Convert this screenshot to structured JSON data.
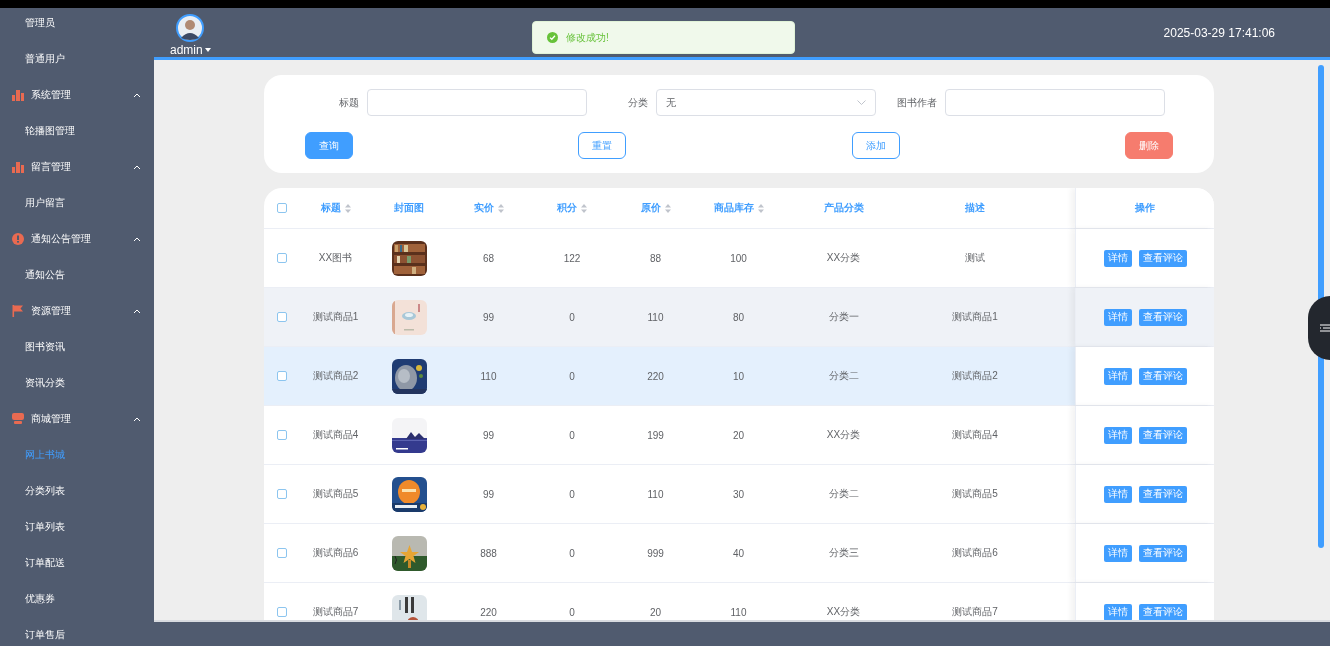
{
  "sidebar": {
    "items": [
      {
        "kind": "link",
        "label": "管理员",
        "selected": false
      },
      {
        "kind": "link",
        "label": "普通用户",
        "selected": false
      },
      {
        "kind": "chart",
        "label": "系统管理",
        "expanded": true,
        "children": [
          {
            "kind": "link",
            "label": "轮播图管理",
            "selected": false
          }
        ]
      },
      {
        "kind": "chart",
        "label": "留言管理",
        "expanded": true,
        "children": [
          {
            "kind": "link",
            "label": "用户留言",
            "selected": false
          }
        ]
      },
      {
        "kind": "info",
        "label": "通知公告管理",
        "expanded": true,
        "children": [
          {
            "kind": "link",
            "label": "通知公告",
            "selected": false
          }
        ]
      },
      {
        "kind": "flag",
        "label": "资源管理",
        "expanded": true,
        "children": [
          {
            "kind": "link",
            "label": "图书资讯",
            "selected": false
          },
          {
            "kind": "link",
            "label": "资讯分类",
            "selected": false
          }
        ]
      },
      {
        "kind": "store",
        "label": "商城管理",
        "expanded": true,
        "children": [
          {
            "kind": "link",
            "label": "网上书城",
            "selected": true
          },
          {
            "kind": "link",
            "label": "分类列表",
            "selected": false
          },
          {
            "kind": "link",
            "label": "订单列表",
            "selected": false
          },
          {
            "kind": "link",
            "label": "订单配送",
            "selected": false
          },
          {
            "kind": "link",
            "label": "优惠券",
            "selected": false
          },
          {
            "kind": "link",
            "label": "订单售后",
            "selected": false
          }
        ]
      }
    ]
  },
  "header": {
    "user": "admin",
    "datetime": "2025-03-29 17:41:06"
  },
  "toast": {
    "kind": "success",
    "message": "修改成功!"
  },
  "search": {
    "fields": [
      {
        "label": "标题",
        "kind": "text"
      },
      {
        "label": "分类",
        "kind": "select",
        "value": "无"
      },
      {
        "label": "图书作者",
        "kind": "text"
      }
    ],
    "buttons": [
      {
        "label": "查询",
        "kind": "primary"
      },
      {
        "label": "重置",
        "kind": "outline"
      },
      {
        "label": "添加",
        "kind": "outline"
      },
      {
        "label": "删除",
        "kind": "danger"
      }
    ]
  },
  "table": {
    "select_all": {
      "checked": false
    },
    "columns": [
      {
        "label": "标题",
        "sortable": true
      },
      {
        "label": "封面图",
        "sortable": false
      },
      {
        "label": "实价",
        "sortable": true
      },
      {
        "label": "积分",
        "sortable": true
      },
      {
        "label": "原价",
        "sortable": true
      },
      {
        "label": "商品库存",
        "sortable": true
      },
      {
        "label": "产品分类",
        "sortable": false
      },
      {
        "label": "描述",
        "sortable": false
      },
      {
        "label": "操作",
        "sortable": false
      }
    ],
    "rows": [
      {
        "checked": false,
        "striped": false,
        "hovered": false,
        "title": "XX图书",
        "cover": {
          "kind": "picture"
        },
        "price": "68",
        "points": "122",
        "original_price": "88",
        "stock": "100",
        "category": "XX分类",
        "description": "测试",
        "actions": [
          "详情",
          "查看评论"
        ]
      },
      {
        "checked": false,
        "striped": true,
        "hovered": false,
        "title": "测试商品1",
        "cover": {
          "kind": "picture"
        },
        "price": "99",
        "points": "0",
        "original_price": "110",
        "stock": "80",
        "category": "分类一",
        "description": "测试商品1",
        "actions": [
          "详情",
          "查看评论"
        ]
      },
      {
        "checked": false,
        "striped": false,
        "hovered": true,
        "title": "测试商品2",
        "cover": {
          "kind": "picture"
        },
        "price": "110",
        "points": "0",
        "original_price": "220",
        "stock": "10",
        "category": "分类二",
        "description": "测试商品2",
        "actions": [
          "详情",
          "查看评论"
        ]
      },
      {
        "checked": false,
        "striped": false,
        "hovered": false,
        "title": "测试商品4",
        "cover": {
          "kind": "picture"
        },
        "price": "99",
        "points": "0",
        "original_price": "199",
        "stock": "20",
        "category": "XX分类",
        "description": "测试商品4",
        "actions": [
          "详情",
          "查看评论"
        ]
      },
      {
        "checked": false,
        "striped": false,
        "hovered": false,
        "title": "测试商品5",
        "cover": {
          "kind": "picture"
        },
        "price": "99",
        "points": "0",
        "original_price": "110",
        "stock": "30",
        "category": "分类二",
        "description": "测试商品5",
        "actions": [
          "详情",
          "查看评论"
        ]
      },
      {
        "checked": false,
        "striped": false,
        "hovered": false,
        "title": "测试商品6",
        "cover": {
          "kind": "picture"
        },
        "price": "888",
        "points": "0",
        "original_price": "999",
        "stock": "40",
        "category": "分类三",
        "description": "测试商品6",
        "actions": [
          "详情",
          "查看评论"
        ]
      },
      {
        "checked": false,
        "striped": false,
        "hovered": false,
        "title": "测试商品7",
        "cover": {
          "kind": "picture"
        },
        "price": "220",
        "points": "0",
        "original_price": "20",
        "stock": "110",
        "category": "XX分类",
        "description": "测试商品7",
        "actions": [
          "详情",
          "查看评论"
        ]
      }
    ]
  }
}
